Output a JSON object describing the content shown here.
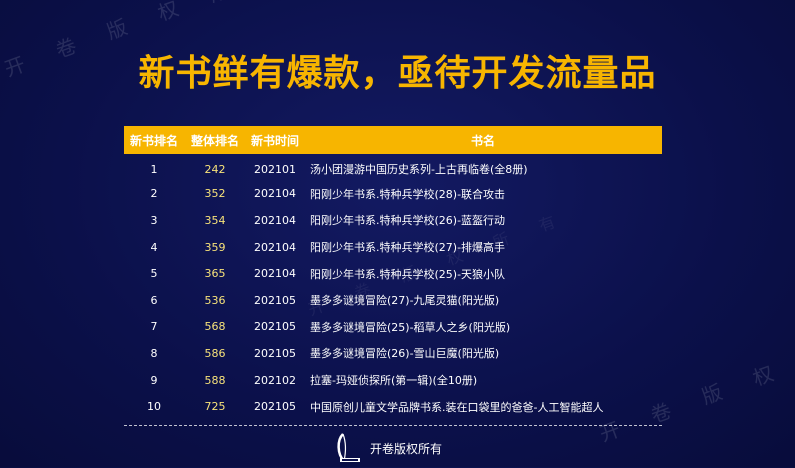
{
  "title": "新书鲜有爆款，亟待开发流量品",
  "watermark_text": "开 卷 版 权 所 有",
  "table": {
    "headers": [
      "新书排名",
      "整体排名",
      "新书时间",
      "书名"
    ],
    "rows": [
      {
        "new_rank": "1",
        "overall_rank": "242",
        "time": "202101",
        "name": "汤小团漫游中国历史系列-上古再临卷(全8册)"
      },
      {
        "new_rank": "2",
        "overall_rank": "352",
        "time": "202104",
        "name": "阳刚少年书系.特种兵学校(28)-联合攻击"
      },
      {
        "new_rank": "3",
        "overall_rank": "354",
        "time": "202104",
        "name": "阳刚少年书系.特种兵学校(26)-蓝盔行动"
      },
      {
        "new_rank": "4",
        "overall_rank": "359",
        "time": "202104",
        "name": "阳刚少年书系.特种兵学校(27)-排爆高手"
      },
      {
        "new_rank": "5",
        "overall_rank": "365",
        "time": "202104",
        "name": "阳刚少年书系.特种兵学校(25)-天狼小队"
      },
      {
        "new_rank": "6",
        "overall_rank": "536",
        "time": "202105",
        "name": "墨多多谜境冒险(27)-九尾灵猫(阳光版)"
      },
      {
        "new_rank": "7",
        "overall_rank": "568",
        "time": "202105",
        "name": "墨多多谜境冒险(25)-稻草人之乡(阳光版)"
      },
      {
        "new_rank": "8",
        "overall_rank": "586",
        "time": "202105",
        "name": "墨多多谜境冒险(26)-雪山巨魔(阳光版)"
      },
      {
        "new_rank": "9",
        "overall_rank": "588",
        "time": "202102",
        "name": "拉塞-玛娅侦探所(第一辑)(全10册)"
      },
      {
        "new_rank": "10",
        "overall_rank": "725",
        "time": "202105",
        "name": "中国原创儿童文学品牌书系.装在口袋里的爸爸-人工智能超人"
      }
    ]
  },
  "footer": {
    "text": "开卷版权所有",
    "logo_icon": "openbook-logo-icon"
  },
  "colors": {
    "background": "#0b104a",
    "accent": "#f7b500",
    "rank_highlight": "#f7e27a"
  }
}
